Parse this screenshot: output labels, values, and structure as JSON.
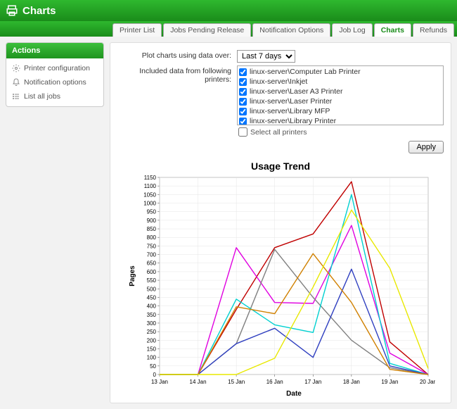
{
  "header": {
    "title": "Charts"
  },
  "tabs": [
    {
      "label": "Printer List"
    },
    {
      "label": "Jobs Pending Release"
    },
    {
      "label": "Notification Options"
    },
    {
      "label": "Job Log"
    },
    {
      "label": "Charts",
      "active": true
    },
    {
      "label": "Refunds"
    }
  ],
  "sidebar": {
    "header": "Actions",
    "items": [
      {
        "label": "Printer configuration",
        "icon": "gear-icon"
      },
      {
        "label": "Notification options",
        "icon": "bell-icon"
      },
      {
        "label": "List all jobs",
        "icon": "list-icon"
      }
    ]
  },
  "form": {
    "range_label": "Plot charts using data over:",
    "range_value": "Last 7 days",
    "printers_label": "Included data from following printers:",
    "select_all_label": "Select all printers",
    "apply_label": "Apply",
    "printers": [
      {
        "label": "linux-server\\Computer Lab Printer",
        "checked": true
      },
      {
        "label": "linux-server\\Inkjet",
        "checked": true
      },
      {
        "label": "linux-server\\Laser A3 Printer",
        "checked": true
      },
      {
        "label": "linux-server\\Laser Printer",
        "checked": true
      },
      {
        "label": "linux-server\\Library MFP",
        "checked": true
      },
      {
        "label": "linux-server\\Library Printer",
        "checked": true
      }
    ]
  },
  "chart_data": {
    "type": "line",
    "title": "Usage Trend",
    "xlabel": "Date",
    "ylabel": "Pages",
    "ylim": [
      0,
      1150
    ],
    "xcategories": [
      "13 Jan",
      "14 Jan",
      "15 Jan",
      "16 Jan",
      "17 Jan",
      "18 Jan",
      "19 Jan",
      "20 Jan"
    ],
    "series": [
      {
        "name": "red",
        "color": "#c00000",
        "values": [
          0,
          0,
          380,
          740,
          820,
          1125,
          190,
          0
        ]
      },
      {
        "name": "magenta",
        "color": "#e000e0",
        "values": [
          0,
          0,
          740,
          420,
          415,
          870,
          125,
          0
        ]
      },
      {
        "name": "gray",
        "color": "#808080",
        "values": [
          0,
          0,
          180,
          730,
          450,
          200,
          40,
          0
        ]
      },
      {
        "name": "cyan",
        "color": "#00d0d0",
        "values": [
          0,
          0,
          440,
          290,
          245,
          1050,
          65,
          0
        ]
      },
      {
        "name": "blue",
        "color": "#3040c0",
        "values": [
          0,
          0,
          180,
          270,
          100,
          615,
          50,
          0
        ]
      },
      {
        "name": "orange",
        "color": "#d08000",
        "values": [
          0,
          0,
          395,
          355,
          705,
          420,
          30,
          0
        ]
      },
      {
        "name": "yellow",
        "color": "#e8e800",
        "values": [
          0,
          0,
          0,
          95,
          510,
          960,
          620,
          35
        ]
      }
    ]
  }
}
